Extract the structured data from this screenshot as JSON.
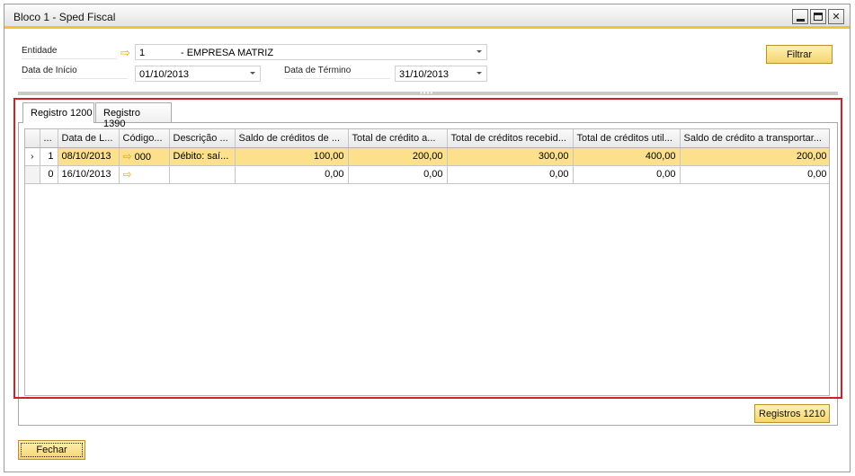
{
  "window": {
    "title": "Bloco 1 - Sped Fiscal"
  },
  "form": {
    "entidade_label": "Entidade",
    "entidade_code": "1",
    "entidade_name": "- EMPRESA MATRIZ",
    "data_inicio_label": "Data de Início",
    "data_inicio_value": "01/10/2013",
    "data_termino_label": "Data de Término",
    "data_termino_value": "31/10/2013"
  },
  "buttons": {
    "filtrar": "Filtrar",
    "registros_1210": "Registros 1210",
    "fechar": "Fechar"
  },
  "tabs": [
    {
      "label": "Registro 1200"
    },
    {
      "label": "Registro 1390"
    }
  ],
  "grid": {
    "columns": [
      "...",
      "Data de L...",
      "Código...",
      "Descrição ...",
      "Saldo de créditos de ...",
      "Total de crédito a...",
      "Total de créditos recebid...",
      "Total de créditos util...",
      "Saldo de crédito a transportar..."
    ],
    "rows": [
      {
        "indicator": "›",
        "no": "1",
        "data": "08/10/2013",
        "codigo": "000",
        "descricao": "Débito: saí...",
        "saldo": "100,00",
        "total_credito": "200,00",
        "total_recebido": "300,00",
        "total_util": "400,00",
        "saldo_transportar": "200,00"
      },
      {
        "indicator": "",
        "no": "0",
        "data": "16/10/2013",
        "codigo": "",
        "descricao": "",
        "saldo": "0,00",
        "total_credito": "0,00",
        "total_recebido": "0,00",
        "total_util": "0,00",
        "saldo_transportar": "0,00"
      }
    ]
  },
  "icons": {
    "link_arrow": "⇨",
    "row_arrow": "⇨"
  },
  "colors": {
    "accent": "#f2c230",
    "selection": "#fce08c",
    "highlight_border": "#d0202a",
    "button_fill": "#f6d56c"
  }
}
